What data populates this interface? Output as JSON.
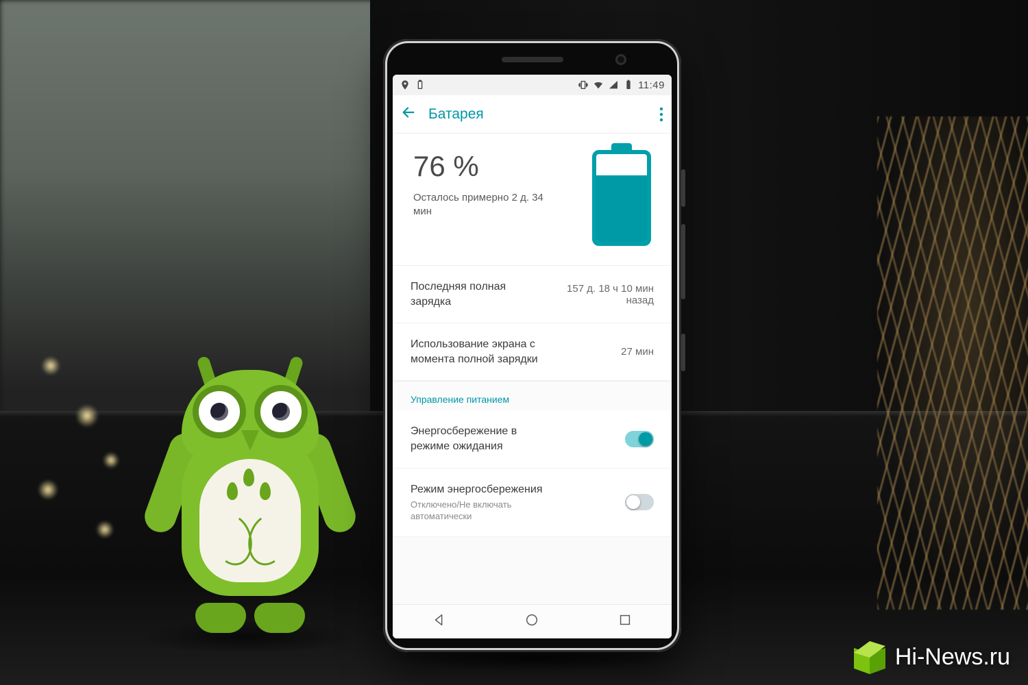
{
  "statusbar": {
    "time": "11:49"
  },
  "appbar": {
    "title": "Батарея"
  },
  "battery": {
    "percent_label": "76 %",
    "percent_value": 76,
    "estimate": "Осталось примерно 2 д. 34 мин"
  },
  "details": {
    "last_full_charge_label": "Последняя полная зарядка",
    "last_full_charge_value": "157 д. 18 ч 10 мин назад",
    "screen_usage_label": "Использование экрана с момента полной зарядки",
    "screen_usage_value": "27 мин"
  },
  "power_section": {
    "title": "Управление питанием",
    "standby_saver": {
      "label": "Энергосбережение в режиме ожидания",
      "on": true
    },
    "battery_saver": {
      "label": "Режим энергосбережения",
      "sub": "Отключено/Не включать автоматически",
      "on": false
    }
  },
  "watermark": {
    "text": "Hi-News.ru"
  },
  "colors": {
    "accent": "#009aa6"
  }
}
